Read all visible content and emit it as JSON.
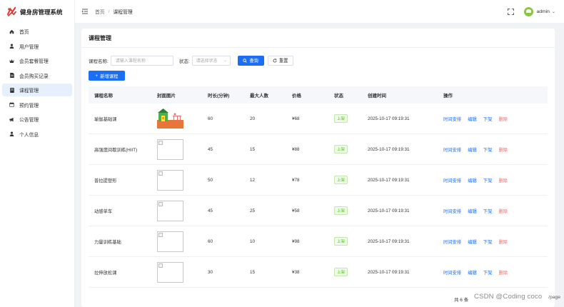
{
  "app": {
    "title": "健身房管理系统"
  },
  "sidebar": {
    "items": [
      {
        "label": "首页",
        "icon": "home-icon"
      },
      {
        "label": "用户管理",
        "icon": "user-icon"
      },
      {
        "label": "会员套餐管理",
        "icon": "crown-icon"
      },
      {
        "label": "会员购买记录",
        "icon": "document-icon"
      },
      {
        "label": "课程管理",
        "icon": "book-icon",
        "active": true
      },
      {
        "label": "预约管理",
        "icon": "calendar-icon"
      },
      {
        "label": "公告管理",
        "icon": "megaphone-icon"
      },
      {
        "label": "个人信息",
        "icon": "user-icon"
      }
    ]
  },
  "header": {
    "breadcrumb_home": "首页",
    "breadcrumb_separator": "/",
    "breadcrumb_current": "课程管理",
    "user_name": "admin"
  },
  "page": {
    "title": "课程管理",
    "filter": {
      "name_label": "课程名称:",
      "name_placeholder": "请输入课程名称",
      "status_label": "状态:",
      "status_placeholder": "请选择状态",
      "search_button": "查询",
      "reset_button": "重置"
    },
    "add_button": "新增课程"
  },
  "table": {
    "columns": [
      "课程名称",
      "封面图片",
      "时长(分钟)",
      "最大人数",
      "价格",
      "状态",
      "创建时间",
      "操作"
    ],
    "rows": [
      {
        "name": "瑜伽基础课",
        "duration": "60",
        "max": "20",
        "price": "¥68",
        "status": "上架",
        "created": "2025-10-17 09:19:31",
        "has_image": true
      },
      {
        "name": "高强度间歇训练(HIIT)",
        "duration": "45",
        "max": "15",
        "price": "¥88",
        "status": "上架",
        "created": "2025-10-17 09:19:31",
        "has_image": false
      },
      {
        "name": "普拉提塑形",
        "duration": "50",
        "max": "12",
        "price": "¥78",
        "status": "上架",
        "created": "2025-10-17 09:19:31",
        "has_image": false
      },
      {
        "name": "动感单车",
        "duration": "45",
        "max": "25",
        "price": "¥58",
        "status": "上架",
        "created": "2025-10-17 09:19:31",
        "has_image": false
      },
      {
        "name": "力量训练基础",
        "duration": "60",
        "max": "10",
        "price": "¥98",
        "status": "上架",
        "created": "2025-10-17 09:19:31",
        "has_image": false
      },
      {
        "name": "拉伸放松课",
        "duration": "30",
        "max": "15",
        "price": "¥38",
        "status": "上架",
        "created": "2025-10-17 09:19:31",
        "has_image": false
      }
    ],
    "operations": [
      "时间安排",
      "编辑",
      "下架",
      "删除"
    ]
  },
  "footer": {
    "total": "共 6 条",
    "page_size": "/page",
    "watermark": "CSDN @Coding coco"
  },
  "colors": {
    "primary": "#1a6ff5",
    "danger": "#f56c6c",
    "success": "#52c41a",
    "logo": "#e53935"
  }
}
